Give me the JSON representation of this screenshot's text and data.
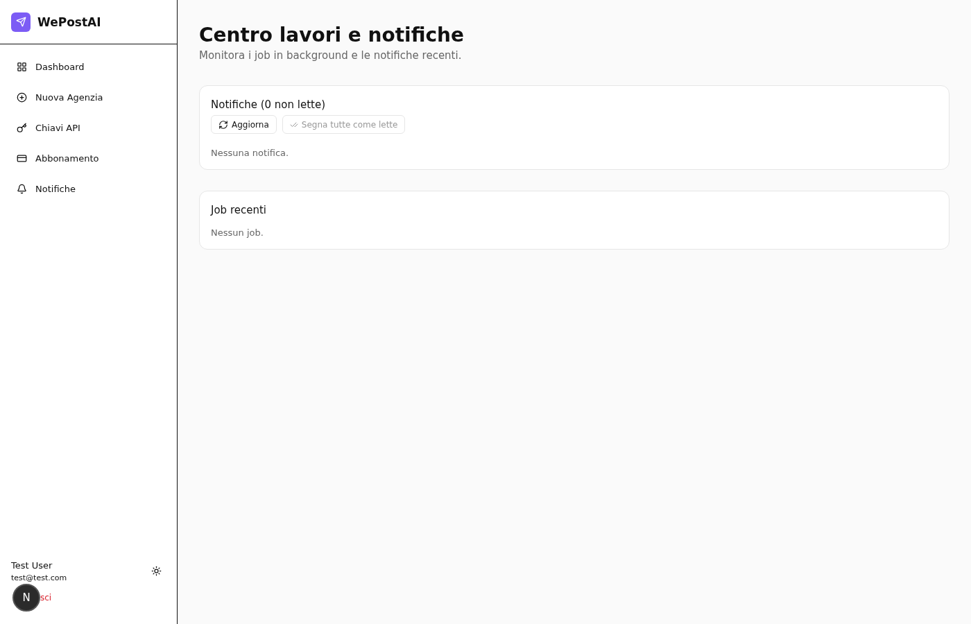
{
  "sidebar": {
    "brand": "WePostAI",
    "items": [
      {
        "label": "Dashboard"
      },
      {
        "label": "Nuova Agenzia"
      },
      {
        "label": "Chiavi API"
      },
      {
        "label": "Abbonamento"
      },
      {
        "label": "Notifiche"
      }
    ],
    "user": {
      "name": "Test User",
      "email": "test@test.com",
      "logout": "sci",
      "badge": "N"
    }
  },
  "page": {
    "title": "Centro lavori e notifiche",
    "subtitle": "Monitora i job in background e le notifiche recenti."
  },
  "cards": [
    {
      "title": "Notifiche (0 non lette)",
      "buttons": [
        {
          "label": "Aggiorna",
          "disabled": false
        },
        {
          "label": "Segna tutte come lette",
          "disabled": true
        }
      ],
      "empty": "Nessuna notifica."
    },
    {
      "title": "Job recenti",
      "empty": "Nessun job."
    }
  ]
}
